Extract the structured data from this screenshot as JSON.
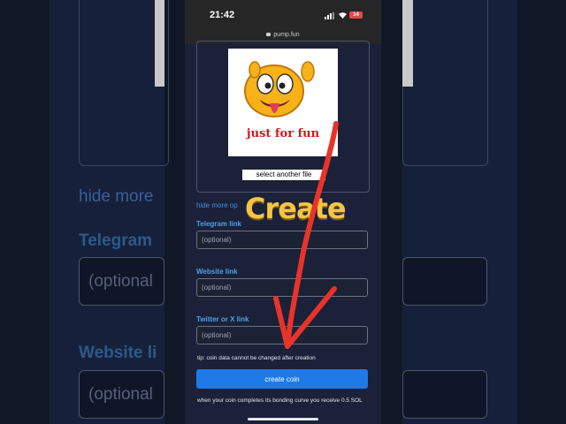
{
  "status_bar": {
    "time": "21:42",
    "battery": "14"
  },
  "url": "pump.fun",
  "image": {
    "caption": "just for fun"
  },
  "file_button": "select another file",
  "hide_more": "hide more op",
  "telegram": {
    "label": "Telegram link",
    "placeholder": "(optional)"
  },
  "website": {
    "label": "Website link",
    "placeholder": "(optional)"
  },
  "twitter": {
    "label": "Twitter or X link",
    "placeholder": "(optional)"
  },
  "tip": "tip: coin data cannot be changed after creation",
  "create_button": "create coin",
  "bonding_note": "when your coin completes its bonding curve you receive 0.5 SOL",
  "overlay_text": "Create",
  "background": {
    "hide_more": "hide more",
    "telegram_label": "Telegram",
    "telegram_placeholder": "(optional",
    "website_label": "Website li",
    "website_placeholder": "(optional"
  },
  "colors": {
    "accent": "#1e7ae6",
    "label": "#52a0e8",
    "overlay": "#f6c544",
    "arrow": "#e8332a"
  }
}
